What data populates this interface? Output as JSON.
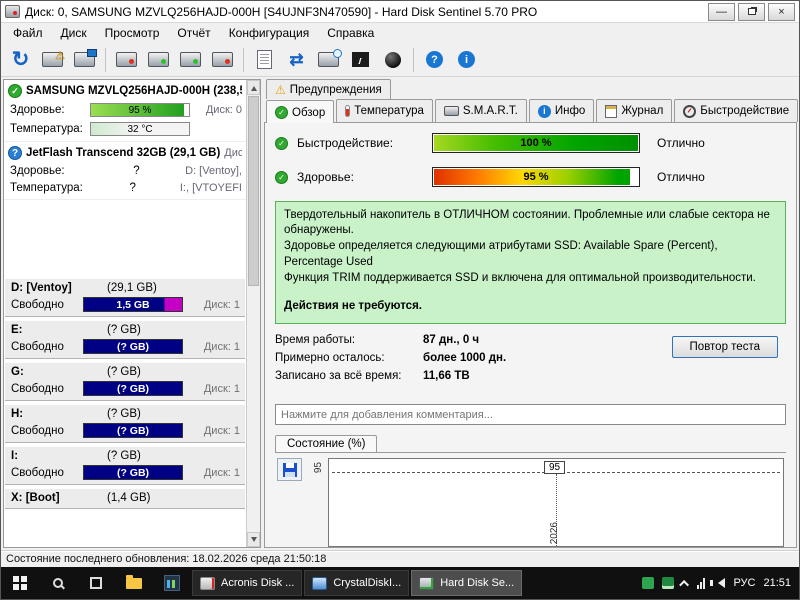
{
  "window": {
    "title": "Диск: 0, SAMSUNG MZVLQ256HAJD-000H [S4UJNF3N470590]  -  Hard Disk Sentinel 5.70 PRO",
    "controls": {
      "minimize": "—",
      "close": "×"
    }
  },
  "icons": {
    "check": "✓",
    "warning": "⚠",
    "question": "?",
    "info": "i",
    "refresh": "↻",
    "sync": "⇄"
  },
  "menu": {
    "items": [
      "Файл",
      "Диск",
      "Просмотр",
      "Отчёт",
      "Конфигурация",
      "Справка"
    ]
  },
  "toolbar": {
    "icons": [
      "refresh-icon",
      "disk-warning-icon",
      "disk-monitor-icon",
      "hdd-red-led-icon",
      "hdd-green-led-icon",
      "hdd-green-led2-icon",
      "hdd-red-led2-icon",
      "report-icon",
      "sync-icon",
      "disk-clock-icon",
      "chart-icon",
      "sphere-icon",
      "help-icon",
      "info-icon"
    ]
  },
  "sidebar": {
    "disks": [
      {
        "name": "SAMSUNG MZVLQ256HAJD-000H (238,5",
        "health_label": "Здоровье:",
        "health_value": "95 %",
        "right1": "Диск: 0",
        "temp_label": "Температура:",
        "temp_value": "32 °C",
        "right2": ""
      },
      {
        "name": "JetFlash Transcend 32GB (29,1 GB)",
        "name_right": "Диск:",
        "health_label": "Здоровье:",
        "health_value": "?",
        "right1": "D: [Ventoy],",
        "temp_label": "Температура:",
        "temp_value": "?",
        "right2": "I:, [VTOYEFI"
      }
    ],
    "partitions": [
      {
        "name": "D: [Ventoy]",
        "size": "(29,1 GB)",
        "free_label": "Свободно",
        "free": "1,5 GB",
        "disk": "Диск: 1"
      },
      {
        "name": "E:",
        "size": "(? GB)",
        "free_label": "Свободно",
        "free": "(? GB)",
        "disk": "Диск: 1"
      },
      {
        "name": "G:",
        "size": "(? GB)",
        "free_label": "Свободно",
        "free": "(? GB)",
        "disk": "Диск: 1"
      },
      {
        "name": "H:",
        "size": "(? GB)",
        "free_label": "Свободно",
        "free": "(? GB)",
        "disk": "Диск: 1"
      },
      {
        "name": "I:",
        "size": "(? GB)",
        "free_label": "Свободно",
        "free": "(? GB)",
        "disk": "Диск: 1"
      },
      {
        "name": "X: [Boot]",
        "size": "(1,4 GB)",
        "free_label": "",
        "free": "",
        "disk": ""
      }
    ]
  },
  "tabs": {
    "warnings": "Предупреждения",
    "items": [
      "Обзор",
      "Температура",
      "S.M.A.R.T.",
      "Инфо",
      "Журнал",
      "Быстродействие"
    ],
    "active": "Обзор"
  },
  "overview": {
    "performance_label": "Быстродействие:",
    "performance_value": "100 %",
    "performance_status": "Отлично",
    "health_label": "Здоровье:",
    "health_value": "95 %",
    "health_status": "Отлично",
    "info": [
      "Твердотельный накопитель в ОТЛИЧНОМ состоянии. Проблемные или слабые сектора не обнаружены.",
      "Здоровье определяется следующими атрибутами SSD: Available Spare (Percent), Percentage Used",
      "Функция TRIM поддерживается SSD и включена для оптимальной производительности."
    ],
    "action": "Действия не требуются.",
    "stats": [
      {
        "label": "Время работы:",
        "value": "87 дн., 0 ч"
      },
      {
        "label": "Примерно осталось:",
        "value": "более 1000 дн."
      },
      {
        "label": "Записано за всё время:",
        "value": "11,66 TB"
      }
    ],
    "retest_button": "Повтор теста",
    "comment_placeholder": "Нажмите для добавления комментария...",
    "chart_tab": "Состояние (%)"
  },
  "chart_data": {
    "type": "line",
    "title": "Состояние (%)",
    "x": [
      "2026"
    ],
    "values": [
      95
    ],
    "annotation": "95",
    "y_tick": "95",
    "x_tick": "2026",
    "ylim": [
      0,
      100
    ],
    "grid": "dashed"
  },
  "statusbar": {
    "text": "Состояние последнего обновления: 18.02.2026 среда 21:50:18"
  },
  "taskbar": {
    "apps": [
      {
        "label": "Acronis Disk ...",
        "active": false
      },
      {
        "label": "CrystalDiskI...",
        "active": false
      },
      {
        "label": "Hard Disk Se...",
        "active": true
      }
    ],
    "tray": {
      "lang": "РУС",
      "time": "21:51"
    }
  }
}
